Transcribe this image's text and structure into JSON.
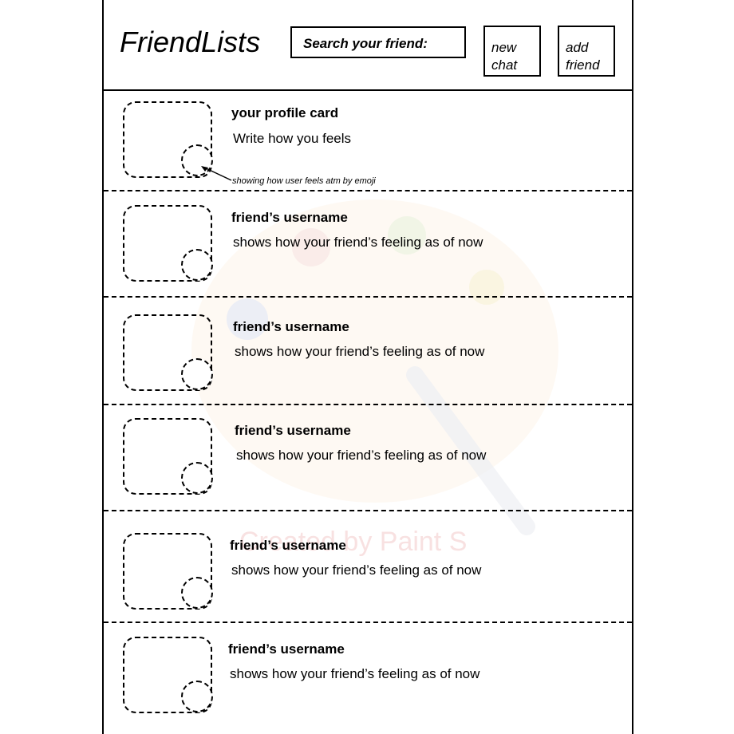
{
  "app": {
    "title": "FriendLists"
  },
  "header": {
    "search_label": "Search your friend:",
    "new_chat_label": "new\nchat",
    "add_friend_label": "add\nfriend"
  },
  "profile_card": {
    "title": "your profile card",
    "status": "Write how you feels",
    "annotation": "showing how user feels atm by emoji"
  },
  "friends": [
    {
      "username": "friend’s username",
      "status": "shows how your friend’s feeling as of now"
    },
    {
      "username": "friend’s username",
      "status": "shows how your friend’s feeling as of now"
    },
    {
      "username": "friend’s username",
      "status": "shows how your friend’s feeling as of now"
    },
    {
      "username": "friend’s username",
      "status": "shows how your friend’s feeling as of now"
    },
    {
      "username": "friend’s username",
      "status": "shows how your friend’s feeling as of now"
    }
  ],
  "watermark": {
    "text": "Created by Paint S"
  }
}
